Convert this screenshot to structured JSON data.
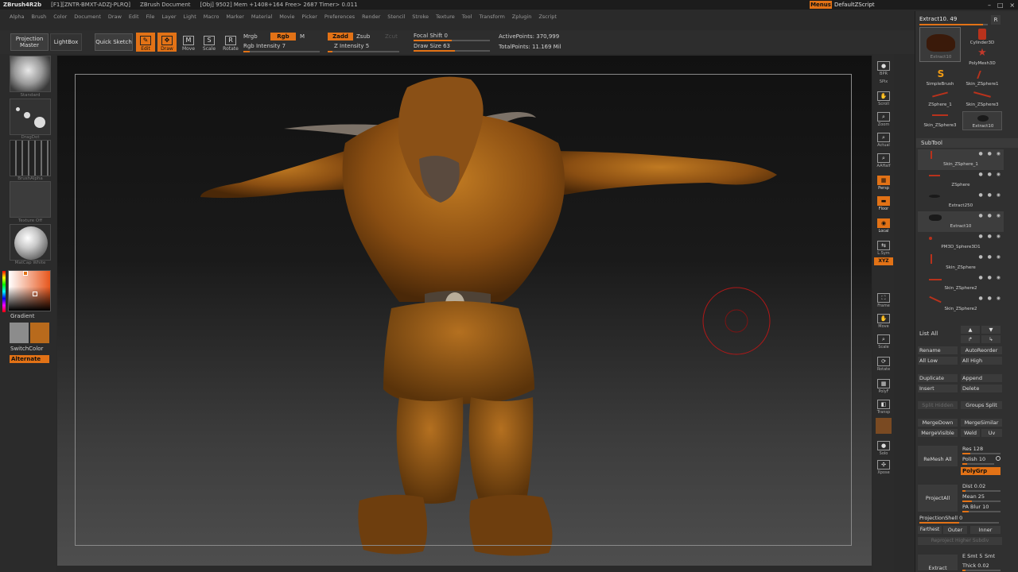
{
  "titlebar": {
    "app": "ZBrush4R2b",
    "key": "[F1][ZNTR-BMXT-ADZJ-PLRQ]",
    "document": "ZBrush Document",
    "stats": "[Obj] 9502] Mem +1408+164 Free> 2687 Timer> 0.011",
    "menus": "Menus",
    "default_zscript": "DefaultZScript"
  },
  "menubar": [
    "Alpha",
    "Brush",
    "Color",
    "Document",
    "Draw",
    "Edit",
    "File",
    "Layer",
    "Light",
    "Macro",
    "Marker",
    "Material",
    "Movie",
    "Picker",
    "Preferences",
    "Render",
    "Stencil",
    "Stroke",
    "Texture",
    "Tool",
    "Transform",
    "Zplugin",
    "Zscript"
  ],
  "topshelf": {
    "projection_master": "Projection Master",
    "lightbox": "LightBox",
    "quick_sketch": "Quick Sketch",
    "edit": "Edit",
    "draw": "Draw",
    "move": "Move",
    "scale": "Scale",
    "rotate": "Rotate",
    "mrgb": "Mrgb",
    "rgb": "Rgb",
    "m": "M",
    "rgb_intensity": "Rgb Intensity 7",
    "zadd": "Zadd",
    "zsub": "Zsub",
    "zcut": "Zcut",
    "z_intensity": "Z Intensity 5",
    "focal_shift": "Focal Shift 0",
    "draw_size": "Draw Size 63",
    "active_points": "ActivePoints: 370,999",
    "total_points": "TotalPoints: 11.169 Mil"
  },
  "lefttray": {
    "brush": "Standard",
    "stroke": "DragDot",
    "alpha": "BrushAlpha",
    "texture": "Texture Off",
    "material": "MatCap White",
    "gradient": "Gradient",
    "switch_color": "SwitchColor",
    "alternate": "Alternate",
    "main_color": "#b86a1c",
    "secondary_color": "#8c8c8c"
  },
  "rightstrip": [
    "BPR",
    "SPix",
    "Scroll",
    "Zoom",
    "Actual",
    "AAHalf",
    "Persp",
    "Floor",
    "Local",
    "L.Sym",
    "XYZ",
    "Frame",
    "Move",
    "Scale",
    "Rotate",
    "PolyF",
    "Transp",
    "Solo",
    "Xpose"
  ],
  "rightpanel": {
    "current_tool": "Extract10. 49",
    "r_btn": "R",
    "tools": [
      {
        "name": "Extract10",
        "sub": "Extract10"
      },
      {
        "name": "Cylinder3D"
      },
      {
        "name": "PolyMesh3D"
      },
      {
        "name": "SimpleBrush"
      },
      {
        "name": "Skin_ZSphere1"
      },
      {
        "name": "ZSphere_1"
      },
      {
        "name": "Skin_ZSphere3"
      },
      {
        "name": "Skin_ZSphere3"
      },
      {
        "name": "Extract10"
      }
    ],
    "subtool_title": "SubTool",
    "subtools": [
      "Skin_ZSphere_1",
      "ZSphere",
      "Extract250",
      "Extract10",
      "PM3D_Sphere3D1",
      "Skin_ZSphere",
      "Skin_ZSphere2",
      "Skin_ZSphere2"
    ],
    "list_all": "List All",
    "rename": "Rename",
    "auto_reorder": "AutoReorder",
    "all_low": "All Low",
    "all_high": "All High",
    "duplicate": "Duplicate",
    "append": "Append",
    "insert": "Insert",
    "delete": "Delete",
    "split_hidden": "Split Hidden",
    "groups_split": "Groups Split",
    "merge_down": "MergeDown",
    "merge_similar": "MergeSimilar",
    "merge_visible": "MergeVisible",
    "weld": "Weld",
    "uv": "Uv",
    "remesh_all": "ReMesh All",
    "res": "Res 128",
    "polish": "Polish 10",
    "polygrp": "PolyGrp",
    "project_all": "ProjectAll",
    "dist": "Dist 0.02",
    "mean": "Mean 25",
    "pa_blur": "PA Blur 10",
    "projection_shell": "ProjectionShell 0",
    "farthest": "Farthest",
    "outer": "Outer",
    "inner": "Inner",
    "reproject": "Reproject Higher Subdiv",
    "extract": "Extract",
    "e_smt": "E Smt 5",
    "s_smt": "Smt",
    "thick": "Thick 0.02"
  }
}
